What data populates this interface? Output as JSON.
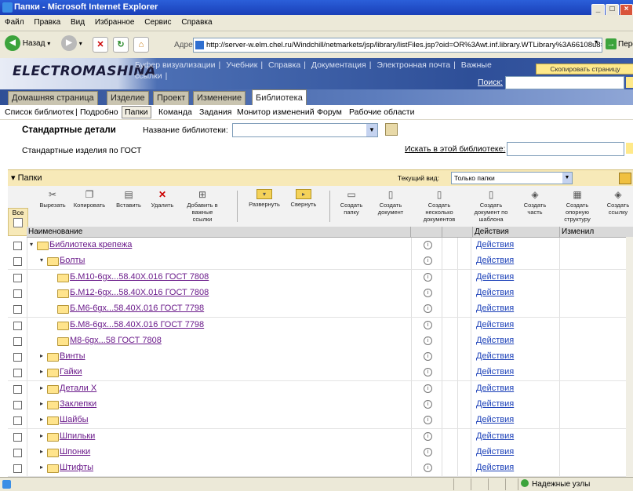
{
  "window": {
    "title": "Папки - Microsoft Internet Explorer",
    "controls": [
      "_",
      "□",
      "×"
    ]
  },
  "menu": [
    "Файл",
    "Правка",
    "Вид",
    "Избранное",
    "Сервис",
    "Справка"
  ],
  "toolbar": {
    "back_label": "Назад",
    "address_label": "Адрес:",
    "address_value": "http://server-w.elm.chel.ru/Windchill/netmarkets/jsp/library/listFiles.jsp?oid=OR%3Awt.inf.library.WTLibrary%3A66108u8=1",
    "go_label": "Перех"
  },
  "banner": {
    "logo": "ELECTROMASHINA",
    "links": [
      "Буфер визуализации",
      "|",
      "Учебник",
      "|",
      "Справка",
      "|",
      "Документация",
      "|",
      "Электронная почта",
      "|",
      "Важные ссылки",
      "|"
    ],
    "copy_page": "Скопировать страницу",
    "search_link": "Поиск:"
  },
  "tabs": [
    "Домашняя страница",
    "Изделие",
    "Проект",
    "Изменение",
    "Библиотека"
  ],
  "active_tab": "Библиотека",
  "subnav": [
    "Список библиотек",
    "|",
    "Подробно",
    "Папки",
    "Команда",
    "Задания",
    "Монитор изменений",
    "Форум",
    "Рабочие области"
  ],
  "library": {
    "title": "Стандартные детали",
    "name_label": "Название библиотеки:",
    "description": "Стандартные изделия по ГОСТ",
    "search_link": "Искать в этой библиотеке:"
  },
  "panel": {
    "title": "Папки",
    "view_label": "Текущий вид:",
    "view_value": "Только папки",
    "all_label": "Все"
  },
  "actions": [
    {
      "icon": "cut-icon",
      "glyph": "✂",
      "label": "Вырезать"
    },
    {
      "icon": "copy-icon",
      "glyph": "❐",
      "label": "Копировать"
    },
    {
      "icon": "paste-icon",
      "glyph": "▤",
      "label": "Вставить"
    },
    {
      "icon": "delete-icon",
      "glyph": "✕",
      "label": "Удалить"
    },
    {
      "icon": "add-link-icon",
      "glyph": "⊞",
      "label": "Добавить в важные ссылки"
    },
    {
      "icon": "expand-icon",
      "glyph": "▾",
      "label": "Развернуть"
    },
    {
      "icon": "collapse-icon",
      "glyph": "▸",
      "label": "Свернуть"
    },
    {
      "icon": "new-folder-icon",
      "glyph": "▭",
      "label": "Создать папку"
    },
    {
      "icon": "new-document-icon",
      "glyph": "▯",
      "label": "Создать документ"
    },
    {
      "icon": "new-multi-doc-icon",
      "glyph": "▯",
      "label": "Создать несколько документов"
    },
    {
      "icon": "doc-template-icon",
      "glyph": "▯",
      "label": "Создать документ по шаблона"
    },
    {
      "icon": "new-part-icon",
      "glyph": "◈",
      "label": "Создать часть"
    },
    {
      "icon": "structure-icon",
      "glyph": "▦",
      "label": "Создать опорную структуру"
    },
    {
      "icon": "new-link-icon",
      "glyph": "◈",
      "label": "Создать ссылку"
    }
  ],
  "columns": [
    "Наименование",
    "Действия",
    "Изменил"
  ],
  "rows": [
    {
      "indent": 0,
      "twisty": "▾",
      "name": "Библиотека крепежа",
      "action": "Действия"
    },
    {
      "indent": 1,
      "twisty": "▾",
      "name": "Болты",
      "action": "Действия"
    },
    {
      "indent": 2,
      "twisty": "",
      "name": "Б.М10-6gх...58.40Х.016 ГОСТ 7808",
      "action": "Действия"
    },
    {
      "indent": 2,
      "twisty": "",
      "name": "Б.М12-6gх...58.40Х.016 ГОСТ 7808",
      "action": "Действия"
    },
    {
      "indent": 2,
      "twisty": "",
      "name": "Б.М6-6gх...58.40Х.016 ГОСТ 7798",
      "action": "Действия"
    },
    {
      "indent": 2,
      "twisty": "",
      "name": "Б.М8-6gх...58.40Х.016 ГОСТ 7798",
      "action": "Действия"
    },
    {
      "indent": 2,
      "twisty": "",
      "name": "М8-6gх...58 ГОСТ 7808",
      "action": "Действия"
    },
    {
      "indent": 1,
      "twisty": "▸",
      "name": "Винты",
      "action": "Действия"
    },
    {
      "indent": 1,
      "twisty": "▸",
      "name": "Гайки",
      "action": "Действия"
    },
    {
      "indent": 1,
      "twisty": "▸",
      "name": "Детали Х",
      "action": "Действия"
    },
    {
      "indent": 1,
      "twisty": "▸",
      "name": "Заклепки",
      "action": "Действия"
    },
    {
      "indent": 1,
      "twisty": "▸",
      "name": "Шайбы",
      "action": "Действия"
    },
    {
      "indent": 1,
      "twisty": "▸",
      "name": "Шпильки",
      "action": "Действия"
    },
    {
      "indent": 1,
      "twisty": "▸",
      "name": "Шпонки",
      "action": "Действия"
    },
    {
      "indent": 1,
      "twisty": "▸",
      "name": "Штифты",
      "action": "Действия"
    }
  ],
  "status": {
    "zone": "Надежные узлы"
  }
}
